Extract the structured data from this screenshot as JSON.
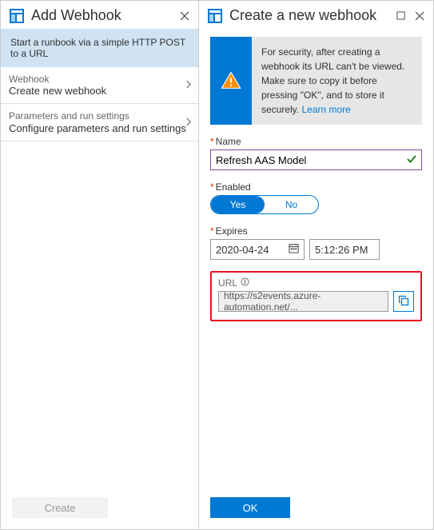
{
  "left": {
    "title": "Add Webhook",
    "banner": "Start a runbook via a simple HTTP POST to a URL",
    "items": [
      {
        "label": "Webhook",
        "value": "Create new webhook"
      },
      {
        "label": "Parameters and run settings",
        "value": "Configure parameters and run settings"
      }
    ],
    "createLabel": "Create"
  },
  "right": {
    "title": "Create a new webhook",
    "notice": {
      "text": "For security, after creating a webhook its URL can't be viewed. Make sure to copy it before pressing \"OK\", and to store it securely. ",
      "linkText": "Learn more"
    },
    "name": {
      "label": "Name",
      "value": "Refresh AAS Model"
    },
    "enabled": {
      "label": "Enabled",
      "yes": "Yes",
      "no": "No"
    },
    "expires": {
      "label": "Expires",
      "date": "2020-04-24",
      "time": "5:12:26 PM"
    },
    "url": {
      "label": "URL",
      "value": "https://s2events.azure-automation.net/..."
    },
    "okLabel": "OK"
  }
}
